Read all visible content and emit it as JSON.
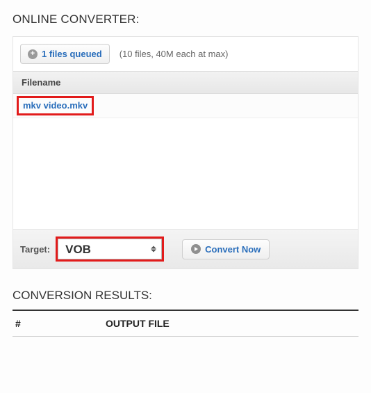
{
  "converter": {
    "title": "ONLINE CONVERTER:",
    "queue_button": "1 files queued",
    "limit_note": "(10 files, 40M each at max)",
    "filename_header": "Filename",
    "files": [
      {
        "name": "mkv video.mkv"
      }
    ],
    "target_label": "Target:",
    "target_value": "VOB",
    "convert_button": "Convert Now"
  },
  "results": {
    "title": "CONVERSION RESULTS:",
    "col_num": "#",
    "col_output": "OUTPUT FILE"
  }
}
